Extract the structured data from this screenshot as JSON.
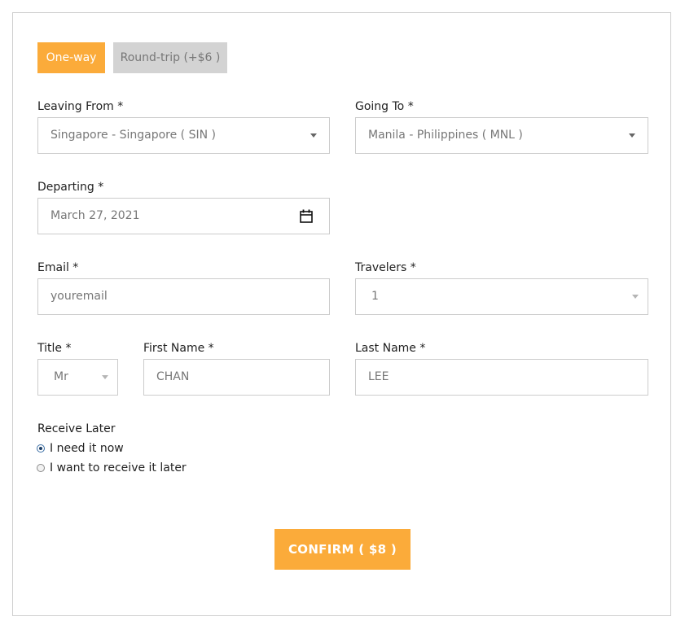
{
  "trip_type": {
    "one_way_label": "One-way",
    "round_trip_label": "Round-trip (+$6 )",
    "selected": "One-way",
    "active_color": "#fbab3a",
    "inactive_color": "#d3d3d3"
  },
  "leaving_from": {
    "label": "Leaving From *",
    "value": "Singapore - Singapore ( SIN )"
  },
  "going_to": {
    "label": "Going To *",
    "value": "Manila - Philippines ( MNL )"
  },
  "departing": {
    "label": "Departing *",
    "value": "March 27, 2021"
  },
  "email": {
    "label": "Email *",
    "placeholder": "youremail"
  },
  "travelers": {
    "label": "Travelers *",
    "value": "1"
  },
  "title_field": {
    "label": "Title *",
    "value": "Mr"
  },
  "first_name": {
    "label": "First Name *",
    "value": "CHAN"
  },
  "last_name": {
    "label": "Last Name *",
    "value": "LEE"
  },
  "receive_later": {
    "label": "Receive Later",
    "options": [
      {
        "label": "I need it now",
        "checked": true
      },
      {
        "label": "I want to receive it later",
        "checked": false
      }
    ]
  },
  "confirm": {
    "label": "CONFIRM ( $8 )",
    "color": "#fbab3a"
  }
}
